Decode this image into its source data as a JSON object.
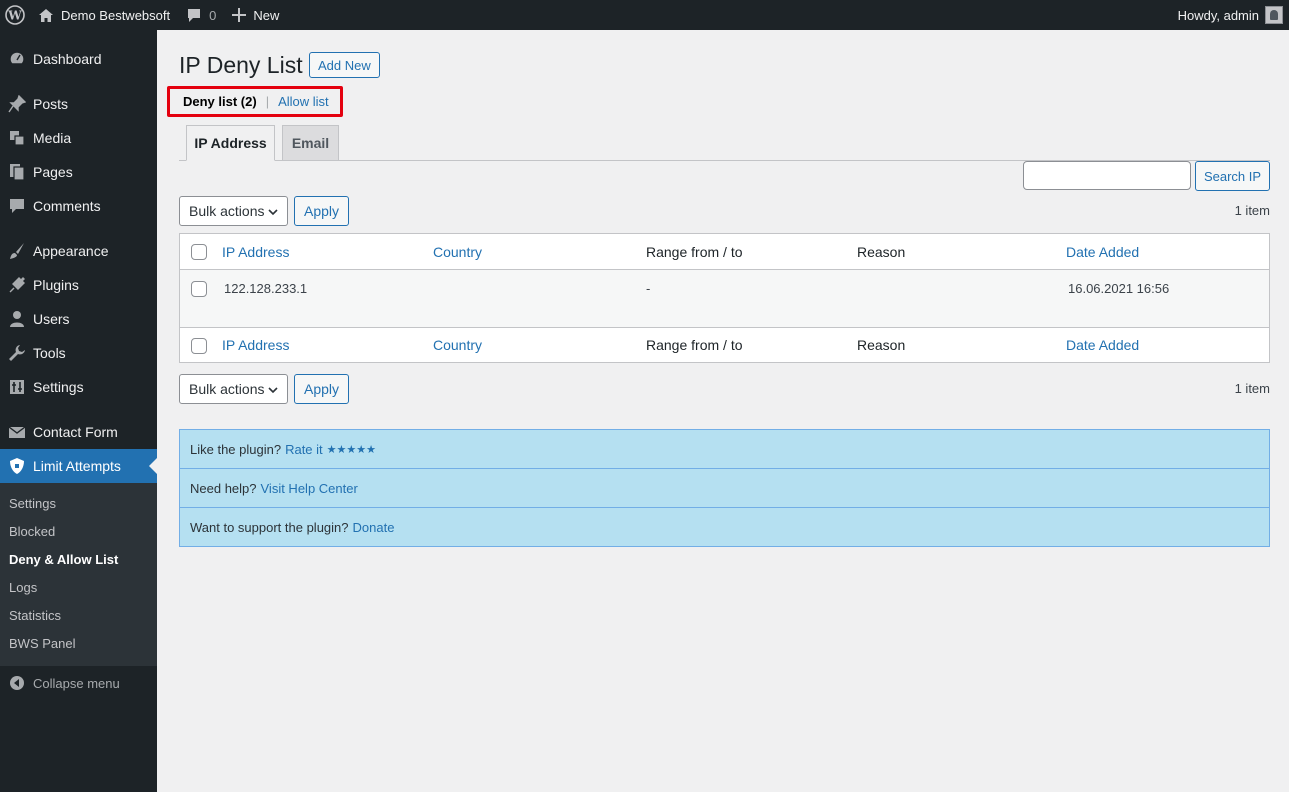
{
  "adminbar": {
    "site_name": "Demo Bestwebsoft",
    "comments_count": "0",
    "new_label": "New",
    "greeting": "Howdy, admin"
  },
  "sidebar": {
    "items": [
      {
        "label": "Dashboard",
        "icon": "dashboard-icon"
      },
      {
        "label": "Posts",
        "icon": "pin-icon"
      },
      {
        "label": "Media",
        "icon": "media-icon"
      },
      {
        "label": "Pages",
        "icon": "pages-icon"
      },
      {
        "label": "Comments",
        "icon": "comment-icon"
      },
      {
        "label": "Appearance",
        "icon": "brush-icon"
      },
      {
        "label": "Plugins",
        "icon": "plug-icon"
      },
      {
        "label": "Users",
        "icon": "user-icon"
      },
      {
        "label": "Tools",
        "icon": "wrench-icon"
      },
      {
        "label": "Settings",
        "icon": "settings-icon"
      },
      {
        "label": "Contact Form",
        "icon": "mail-icon"
      },
      {
        "label": "Limit Attempts",
        "icon": "shield-icon"
      }
    ],
    "submenu": [
      "Settings",
      "Blocked",
      "Deny & Allow List",
      "Logs",
      "Statistics",
      "BWS Panel"
    ],
    "collapse_label": "Collapse menu"
  },
  "page": {
    "title": "IP Deny List",
    "add_new": "Add New",
    "filters": {
      "deny": "Deny list (2)",
      "separator": "|",
      "allow": "Allow list"
    },
    "tabs": [
      "IP Address",
      "Email"
    ],
    "search_button": "Search IP",
    "bulk_actions": "Bulk actions",
    "apply": "Apply",
    "item_count": "1 item"
  },
  "table": {
    "columns": [
      "IP Address",
      "Country",
      "Range from / to",
      "Reason",
      "Date Added"
    ],
    "rows": [
      {
        "ip": "122.128.233.1",
        "country": "",
        "range": "-",
        "reason": "",
        "date": "16.06.2021 16:56"
      }
    ]
  },
  "notice": {
    "rate_text": "Like the plugin?",
    "rate_link": "Rate it",
    "stars": "★★★★★",
    "help_text": "Need help?",
    "help_link": "Visit Help Center",
    "support_text": "Want to support the plugin?",
    "support_link": "Donate"
  }
}
